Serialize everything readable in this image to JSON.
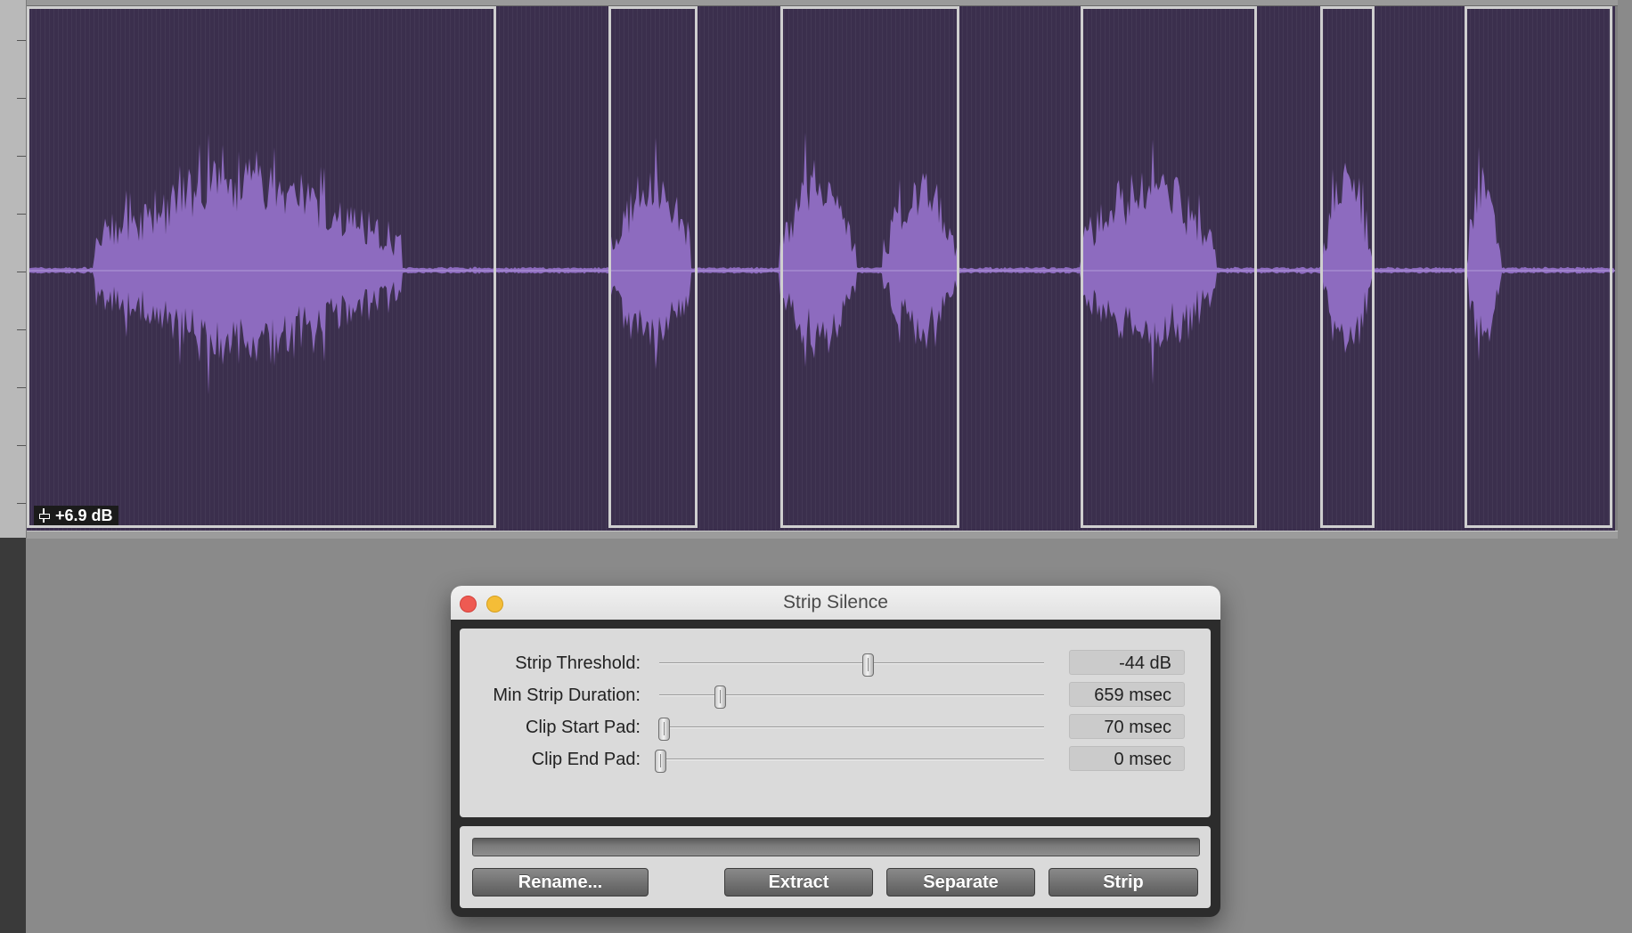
{
  "track": {
    "clip_gain": "+6.9 dB",
    "waveform_color": "#8d6bbf",
    "background_color": "#3b2f4d"
  },
  "dialog": {
    "title": "Strip Silence",
    "params": [
      {
        "label": "Strip Threshold:",
        "value": "-44 dB",
        "slider_fraction": 0.54
      },
      {
        "label": "Min Strip Duration:",
        "value": "659 msec",
        "slider_fraction": 0.155
      },
      {
        "label": "Clip Start Pad:",
        "value": "70 msec",
        "slider_fraction": 0.01
      },
      {
        "label": "Clip End Pad:",
        "value": "0 msec",
        "slider_fraction": 0.0
      }
    ],
    "buttons": {
      "rename": "Rename...",
      "extract": "Extract",
      "separate": "Separate",
      "strip": "Strip"
    }
  }
}
